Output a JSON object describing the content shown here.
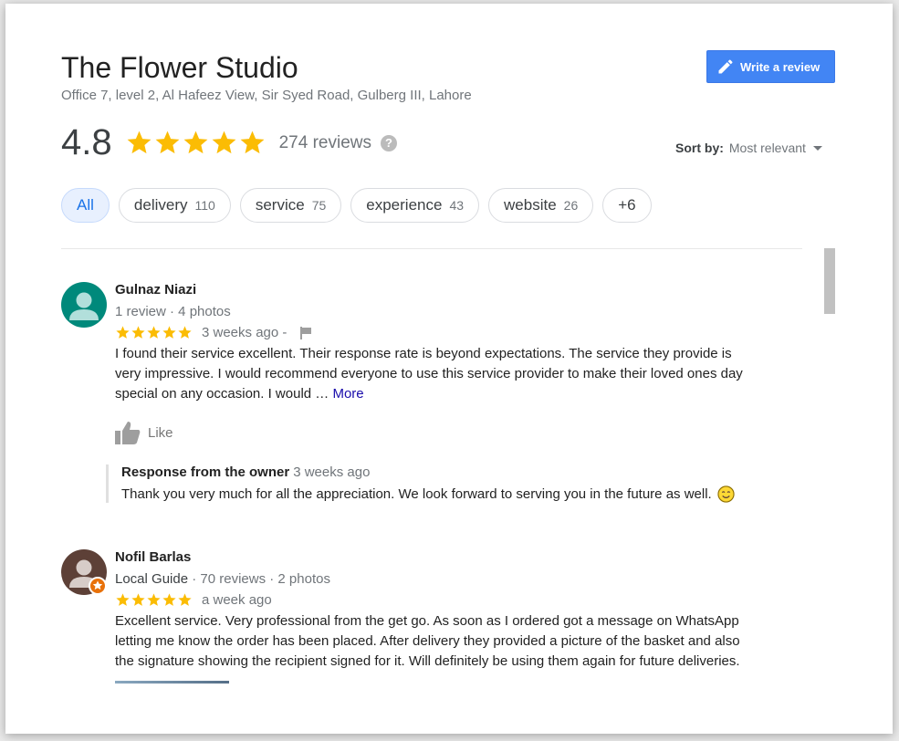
{
  "place": {
    "name": "The Flower Studio",
    "address": "Office 7, level 2, Al Hafeez View, Sir Syed Road, Gulberg III, Lahore",
    "write_review_label": "Write a review",
    "rating": "4.8",
    "stars": 5,
    "review_count": "274 reviews",
    "help_icon": "?"
  },
  "sort": {
    "label": "Sort by:",
    "value": "Most relevant"
  },
  "chips": [
    {
      "label": "All",
      "count": "",
      "active": true
    },
    {
      "label": "delivery",
      "count": "110"
    },
    {
      "label": "service",
      "count": "75"
    },
    {
      "label": "experience",
      "count": "43"
    },
    {
      "label": "website",
      "count": "26"
    },
    {
      "label": "+6",
      "count": ""
    }
  ],
  "reviews": [
    {
      "name": "Gulnaz Niazi",
      "meta": "1 review · 4 photos",
      "stars": 5,
      "time": "3 weeks ago",
      "time_suffix": " -",
      "text_line1": "I found their service excellent. Their response rate is beyond expectations. The service they provide is",
      "text_line2": "very impressive. I would recommend everyone to use this service provider to make their loved ones day",
      "text_line3": "special on any occasion. I would …",
      "more_label": "More",
      "like_label": "Like",
      "owner_label": "Response from the owner",
      "owner_time": "3 weeks ago",
      "owner_text": "Thank you very much for all the appreciation. We look forward to serving you in the future as well.",
      "avatar_color": "#00897b"
    },
    {
      "name": "Nofil Barlas",
      "guide": "Local Guide",
      "meta": " · 70 reviews · 2 photos",
      "stars": 5,
      "time": "a week ago",
      "text_line1": "Excellent service. Very professional from the get go. As soon as I ordered got a message on WhatsApp",
      "text_line2": "letting me know the order has been placed. After delivery they provided a picture of the basket and also",
      "text_line3": "the signature showing the recipient signed for it. Will definitely be using them again for future deliveries.",
      "avatar_color": "#5d4037",
      "badge_color": "#e8710a"
    }
  ],
  "colors": {
    "star": "#fbbc04",
    "accent": "#4285f4"
  }
}
